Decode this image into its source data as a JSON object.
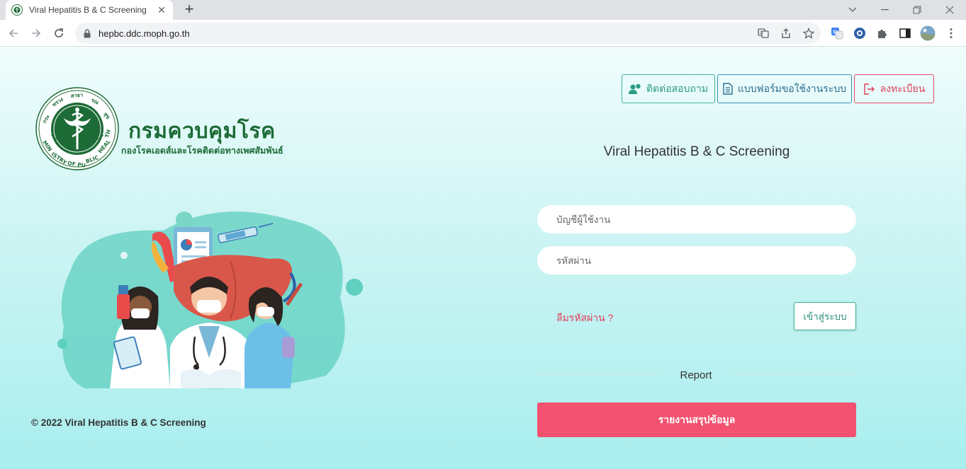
{
  "browser": {
    "tab_title": "Viral Hepatitis B & C Screening | ",
    "tab_close": "✕",
    "new_tab": "+",
    "url": "hepbc.ddc.moph.go.th"
  },
  "header": {
    "logo_title": "กรมควบคุมโรค",
    "logo_subtitle": "กองโรคเอดส์และโรคติดต่อทางเพศสัมพันธ์",
    "contact_label": "ติดต่อสอบถาม",
    "form_label": "แบบฟอร์มขอใช้งานระบบ",
    "register_label": "ลงทะเบียน"
  },
  "login": {
    "title": "Viral Hepatitis B & C Screening",
    "username_placeholder": "บัญชีผู้ใช้งาน",
    "password_placeholder": "รหัสผ่าน",
    "forgot_label": "ลืมรหัสผ่าน ?",
    "submit_label": "เข้าสู่ระบบ"
  },
  "report": {
    "divider_label": "Report",
    "button_label": "รายงานสรุปข้อมูล"
  },
  "footer": {
    "copyright": "© 2022 Viral Hepatitis B & C Screening"
  },
  "colors": {
    "brand_green": "#1d6b36",
    "accent_teal": "#3bb39b",
    "accent_red": "#f25270",
    "page_bg_bottom": "#a9eeee"
  }
}
